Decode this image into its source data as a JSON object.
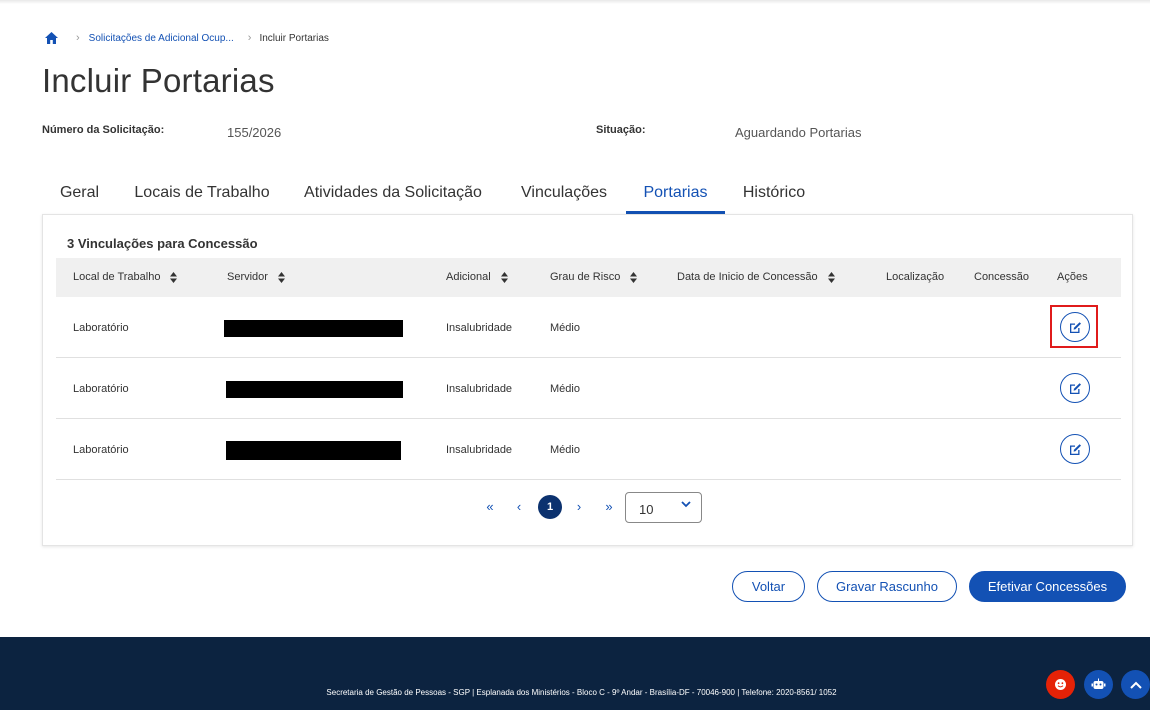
{
  "breadcrumb": {
    "parent": "Solicitações de Adicional Ocup...",
    "current": "Incluir Portarias"
  },
  "page": {
    "title": "Incluir Portarias"
  },
  "info": {
    "request_number_label": "Número da Solicitação:",
    "request_number_value": "155/2026",
    "status_label": "Situação:",
    "status_value": "Aguardando Portarias"
  },
  "tabs": [
    {
      "label": "Geral",
      "active": false
    },
    {
      "label": "Locais de Trabalho",
      "active": false
    },
    {
      "label": "Atividades da Solicitação",
      "active": false
    },
    {
      "label": "Vinculações",
      "active": false
    },
    {
      "label": "Portarias",
      "active": true
    },
    {
      "label": "Histórico",
      "active": false
    }
  ],
  "table": {
    "title": "3 Vinculações para Concessão",
    "columns": [
      "Local de Trabalho",
      "Servidor",
      "Adicional",
      "Grau de Risco",
      "Data de Inicio de Concessão",
      "Localização",
      "Concessão",
      "Ações"
    ],
    "rows": [
      {
        "local": "Laboratório",
        "servidor": "[redacted]",
        "adicional": "Insalubridade",
        "grau": "Médio",
        "data_inicio": "",
        "localizacao": "",
        "concessao": ""
      },
      {
        "local": "Laboratório",
        "servidor": "[redacted]",
        "adicional": "Insalubridade",
        "grau": "Médio",
        "data_inicio": "",
        "localizacao": "",
        "concessao": ""
      },
      {
        "local": "Laboratório",
        "servidor": "[redacted]",
        "adicional": "Insalubridade",
        "grau": "Médio",
        "data_inicio": "",
        "localizacao": "",
        "concessao": ""
      }
    ]
  },
  "pagination": {
    "current_page": "1",
    "page_size": "10"
  },
  "actions": {
    "back_label": "Voltar",
    "save_draft_label": "Gravar Rascunho",
    "submit_label": "Efetivar Concessões"
  },
  "footer": {
    "text": "Secretaria de Gestão de Pessoas - SGP | Esplanada dos Ministérios - Bloco C - 9º Andar - Brasília-DF - 70046-900 | Telefone: 2020-8561/ 1052"
  },
  "colors": {
    "primary": "#1351b4",
    "navy": "#0c326f",
    "footer_bg": "#0c2340",
    "highlight": "#e01b1b",
    "feedback_fab": "#e52207"
  },
  "icons": [
    "home-icon",
    "chevron-right-icon",
    "sort-icon",
    "edit-icon",
    "first-page-icon",
    "prev-page-icon",
    "next-page-icon",
    "last-page-icon",
    "chevron-down-icon",
    "feedback-icon",
    "chatbot-icon",
    "back-to-top-icon"
  ]
}
